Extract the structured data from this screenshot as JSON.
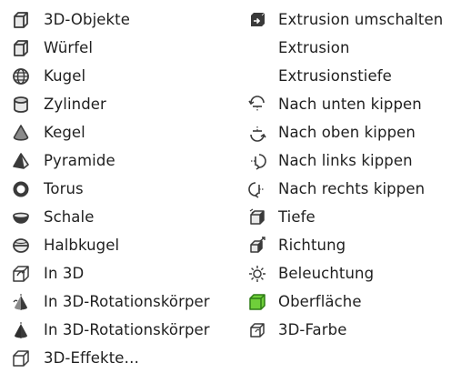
{
  "menu_left": [
    {
      "label": "3D-Objekte",
      "icon": "cube-icon"
    },
    {
      "label": "Würfel",
      "icon": "cube-icon"
    },
    {
      "label": "Kugel",
      "icon": "sphere-icon"
    },
    {
      "label": "Zylinder",
      "icon": "cylinder-icon"
    },
    {
      "label": "Kegel",
      "icon": "cone-icon"
    },
    {
      "label": "Pyramide",
      "icon": "pyramid-icon"
    },
    {
      "label": "Torus",
      "icon": "torus-icon"
    },
    {
      "label": "Schale",
      "icon": "shell-icon"
    },
    {
      "label": "Halbkugel",
      "icon": "half-sphere-icon"
    },
    {
      "label": "In 3D",
      "icon": "to-3d-icon"
    },
    {
      "label": "In 3D-Rotationskörper",
      "icon": "rotation-body-icon"
    },
    {
      "label": "In 3D-Rotationskörper",
      "icon": "rotation-body-icon"
    },
    {
      "label": "3D-Effekte…",
      "icon": "3d-effects-icon"
    }
  ],
  "menu_right": [
    {
      "label": "Extrusion umschalten",
      "icon": "extrusion-toggle-icon"
    },
    {
      "label": "Extrusion",
      "icon": ""
    },
    {
      "label": "Extrusionstiefe",
      "icon": ""
    },
    {
      "label": "Nach unten kippen",
      "icon": "tilt-down-icon"
    },
    {
      "label": "Nach oben kippen",
      "icon": "tilt-up-icon"
    },
    {
      "label": "Nach links kippen",
      "icon": "tilt-left-icon"
    },
    {
      "label": "Nach rechts kippen",
      "icon": "tilt-right-icon"
    },
    {
      "label": "Tiefe",
      "icon": "depth-icon"
    },
    {
      "label": "Richtung",
      "icon": "direction-icon"
    },
    {
      "label": "Beleuchtung",
      "icon": "lighting-icon"
    },
    {
      "label": "Oberfläche",
      "icon": "surface-icon"
    },
    {
      "label": "3D-Farbe",
      "icon": "3d-color-icon"
    }
  ],
  "colors": {
    "icon_dark": "#3a3a3a",
    "surface_green": "#6fcf3a"
  }
}
